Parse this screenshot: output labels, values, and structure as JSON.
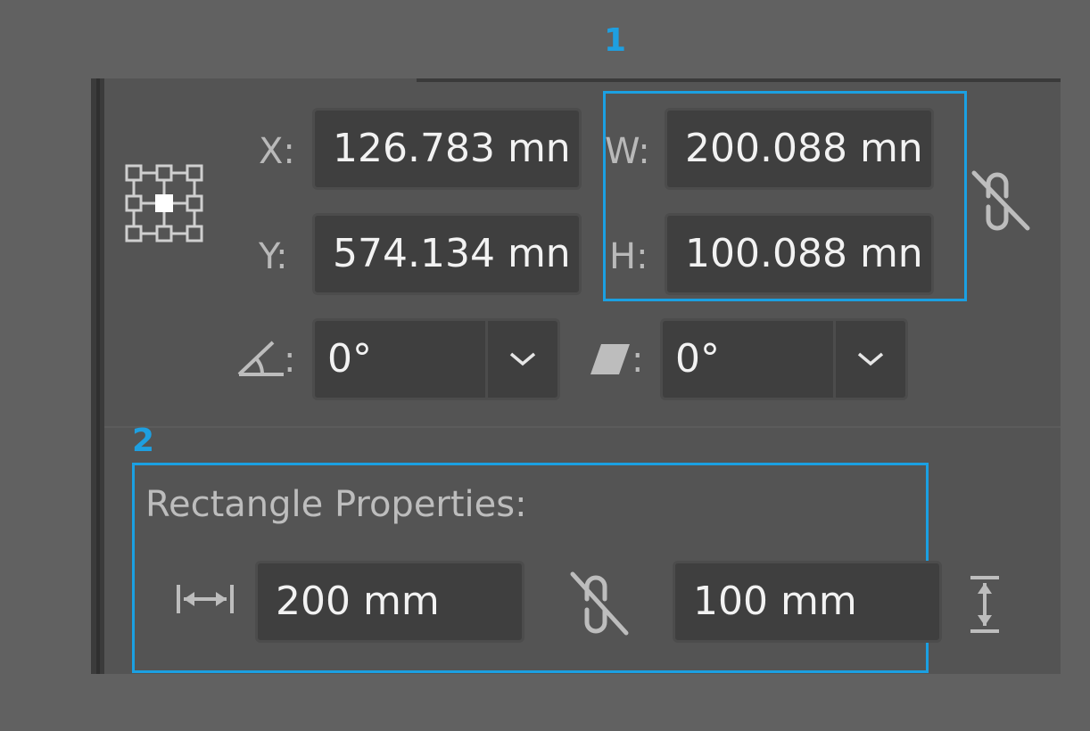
{
  "callouts": {
    "one": "1",
    "two": "2"
  },
  "transform": {
    "x_label": "X:",
    "x_value": "126.783 mn",
    "y_label": "Y:",
    "y_value": "574.134 mn",
    "w_label": "W:",
    "w_value": "200.088 mn",
    "h_label": "H:",
    "h_value": "100.088 mn",
    "angle_label": ":",
    "angle_value": "0°",
    "shear_label": ":",
    "shear_value": "0°"
  },
  "rectangle_properties": {
    "title": "Rectangle Properties:",
    "width_value": "200 mm",
    "height_value": "100 mm"
  },
  "icons": {
    "reference_point": "reference-point-grid-icon",
    "constrain_proportions": "unlinked-chain-icon",
    "rotate_angle": "angle-icon",
    "shear": "shear-icon",
    "dropdown": "chevron-down-icon",
    "width": "horizontal-arrows-icon",
    "height": "vertical-arrows-icon"
  },
  "colors": {
    "highlight": "#1ba0e2",
    "panel": "#545454",
    "background": "#616161"
  }
}
